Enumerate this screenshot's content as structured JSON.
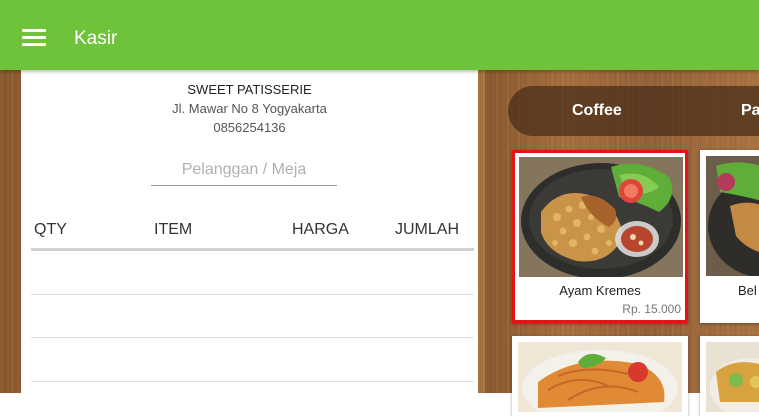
{
  "app": {
    "title": "Kasir",
    "menu_icon": "hamburger-menu-icon",
    "accent": "#6ec33a"
  },
  "receipt": {
    "store_name": "SWEET PATISSERIE",
    "address": "Jl. Mawar No 8 Yogyakarta",
    "phone": "0856254136",
    "customer_placeholder": "Pelanggan / Meja",
    "customer_value": "",
    "columns": [
      "QTY",
      "ITEM",
      "HARGA",
      "JUMLAH"
    ],
    "rows": []
  },
  "categories": [
    {
      "label": "Coffee"
    },
    {
      "label": "Pa"
    }
  ],
  "products": [
    {
      "name": "Ayam Kremes",
      "price": "Rp. 15.000",
      "selected": true,
      "selected_color": "#e21414"
    },
    {
      "name": "Bel",
      "price": ""
    },
    {
      "name": "",
      "price": ""
    },
    {
      "name": "",
      "price": ""
    }
  ]
}
